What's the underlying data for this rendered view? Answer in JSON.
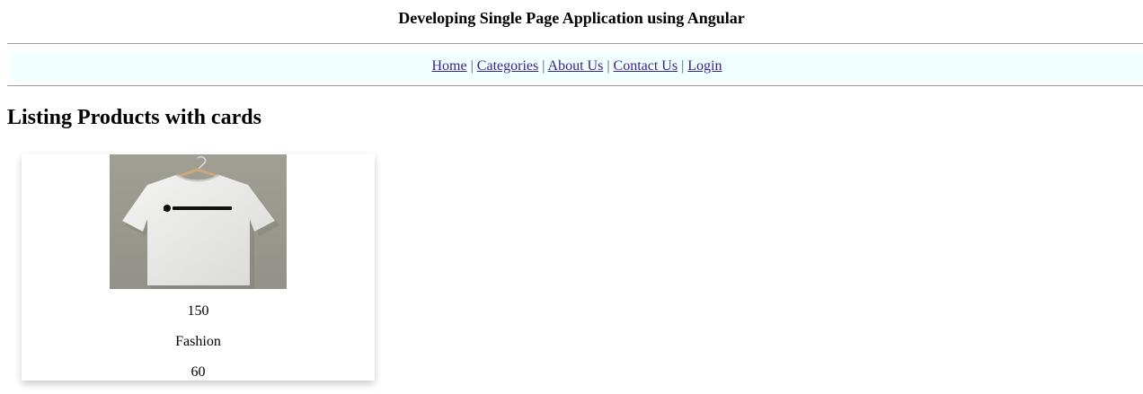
{
  "header": {
    "title": "Developing Single Page Application using Angular"
  },
  "nav": {
    "links": [
      {
        "label": "Home"
      },
      {
        "label": "Categories"
      },
      {
        "label": "About Us"
      },
      {
        "label": "Contact Us"
      },
      {
        "label": "Login"
      }
    ],
    "separator": "|"
  },
  "main": {
    "heading": "Listing Products with cards",
    "products": [
      {
        "image_icon": "tshirt-image",
        "image_text": "DEVELOPER",
        "price": "150",
        "category": "Fashion",
        "quantity": "60"
      }
    ]
  },
  "colors": {
    "nav_background": "#f0ffff",
    "link": "#3a1f8a",
    "rule": "#9a9a9a"
  }
}
